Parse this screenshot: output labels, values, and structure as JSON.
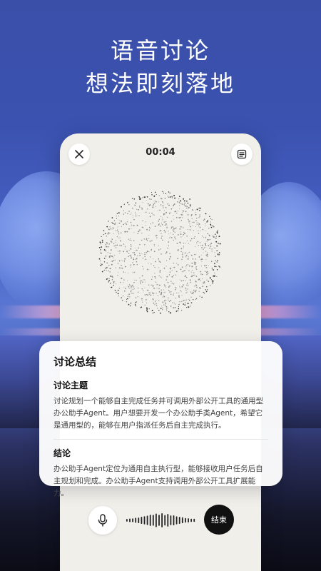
{
  "headline": {
    "line1": "语音讨论",
    "line2": "想法即刻落地"
  },
  "phone": {
    "timer": "00:04",
    "close_icon": "close-icon",
    "notes_icon": "notes-icon"
  },
  "summary": {
    "title": "讨论总结",
    "topic_title": "讨论主题",
    "topic_body": "讨论规划一个能够自主完成任务并可调用外部公开工具的通用型办公助手Agent。用户想要开发一个办公助手类Agent，希望它是通用型的，能够在用户指派任务后自主完成执行。",
    "conclusion_title": "结论",
    "conclusion_body": "办公助手Agent定位为通用自主执行型，能够接收用户任务后自主规划和完成。办公助手Agent支持调用外部公开工具扩展能力。"
  },
  "controls": {
    "mic_icon": "microphone-icon",
    "end_label": "结束"
  },
  "colors": {
    "background_top": "#3a4fa8",
    "card": "#f1efea",
    "end_button": "#111111"
  }
}
